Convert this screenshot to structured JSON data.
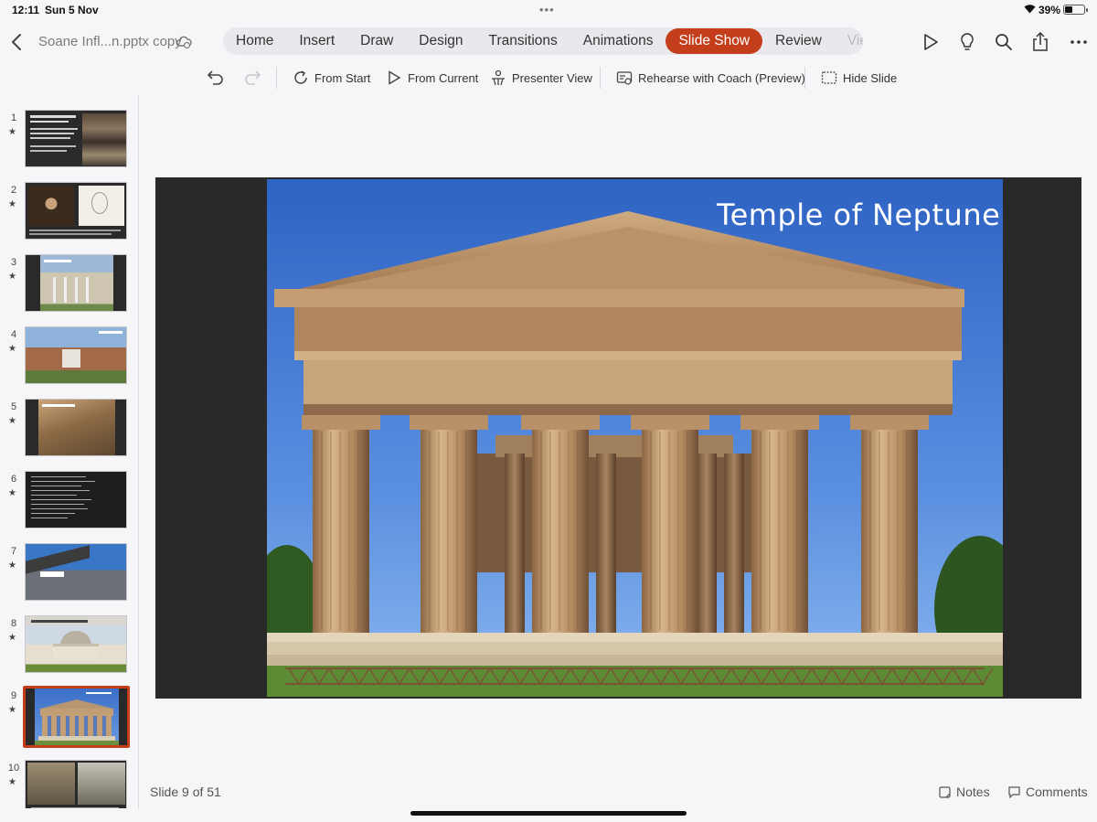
{
  "status": {
    "time": "12:11",
    "date": "Sun 5 Nov",
    "battery_pct": "39%",
    "battery_level": 0.39
  },
  "header": {
    "doc_title": "Soane Infl...n.pptx copy"
  },
  "tabs": [
    {
      "label": "Home"
    },
    {
      "label": "Insert"
    },
    {
      "label": "Draw"
    },
    {
      "label": "Design"
    },
    {
      "label": "Transitions"
    },
    {
      "label": "Animations"
    },
    {
      "label": "Slide Show"
    },
    {
      "label": "Review"
    },
    {
      "label": "View"
    }
  ],
  "active_tab": "Slide Show",
  "accent_color": "#c43e1c",
  "ribbon": {
    "from_start": "From Start",
    "from_current": "From Current",
    "presenter_view": "Presenter View",
    "rehearse": "Rehearse with Coach (Preview)",
    "hide_slide": "Hide Slide"
  },
  "thumbnails": [
    {
      "num": "1",
      "star": "★"
    },
    {
      "num": "2",
      "star": "★"
    },
    {
      "num": "3",
      "star": "★"
    },
    {
      "num": "4",
      "star": "★"
    },
    {
      "num": "5",
      "star": "★"
    },
    {
      "num": "6",
      "star": "★"
    },
    {
      "num": "7",
      "star": "★"
    },
    {
      "num": "8",
      "star": "★"
    },
    {
      "num": "9",
      "star": "★"
    },
    {
      "num": "10",
      "star": "★"
    }
  ],
  "slide": {
    "title": "Temple of Neptune"
  },
  "footer": {
    "slide_count": "Slide 9 of 51",
    "notes": "Notes",
    "comments": "Comments"
  }
}
